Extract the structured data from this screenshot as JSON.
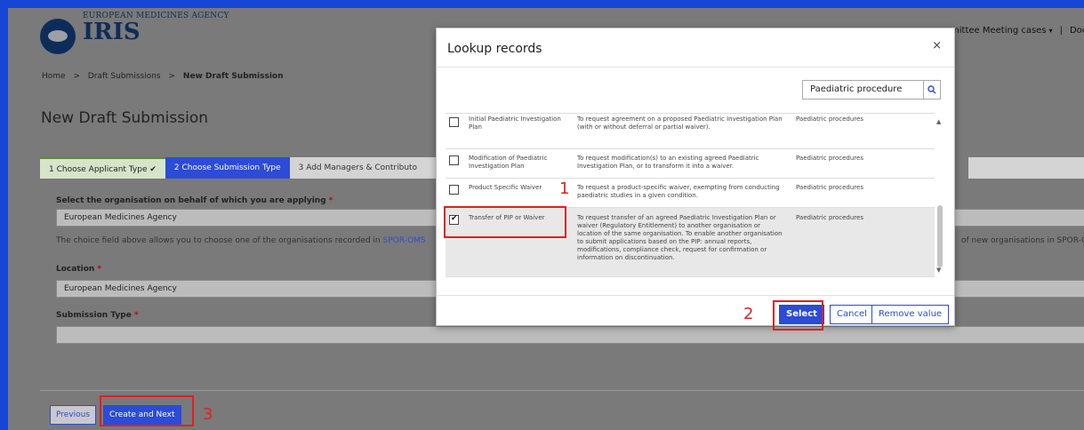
{
  "header": {
    "agency": "EUROPEAN MEDICINES AGENCY",
    "app_name": "IRIS",
    "nav_menu": "mittee Meeting cases",
    "nav_doc": "Doc"
  },
  "breadcrumb": {
    "home": "Home",
    "drafts": "Draft Submissions",
    "current": "New Draft Submission",
    "sep": ">"
  },
  "page_title": "New Draft Submission",
  "steps": {
    "step1": "1  Choose Applicant Type",
    "step1_check": "✔",
    "step2": "2  Choose Submission Type",
    "step3": "3  Add Managers & Contributo"
  },
  "form": {
    "org_label": "Select the organisation on behalf of which you are applying",
    "org_value": "European Medicines Agency",
    "info_text": "The choice field above allows you to choose one of the organisations recorded in ",
    "info_link": "SPOR-OMS",
    "info_right": "of new organisations in SPOR-O",
    "location_label": "Location",
    "location_value": "European Medicines Agency",
    "submission_type_label": "Submission Type",
    "submission_type_value": "",
    "required_mark": "*"
  },
  "footer": {
    "previous_label": "Previous",
    "create_label": "Create and Next"
  },
  "annotations": {
    "one": "1",
    "two": "2",
    "three": "3"
  },
  "modal": {
    "title": "Lookup records",
    "close": "×",
    "search_value": "Paediatric procedure",
    "rows": [
      {
        "name": "Initial Paediatric Investigation Plan",
        "description": "To request agreement on a proposed Paediatric Investigation Plan (with or without deferral or partial waiver).",
        "type": "Paediatric procedures",
        "checked": false
      },
      {
        "name": "Modification of Paediatric Investigation Plan",
        "description": "To request modification(s) to an existing agreed Paediatric Investigation Plan, or to transform it into a waiver.",
        "type": "Paediatric procedures",
        "checked": false
      },
      {
        "name": "Product Specific Waiver",
        "description": "To request a product-specific waiver, exempting from conducting paediatric studies in a given condition.",
        "type": "Paediatric procedures",
        "checked": false
      },
      {
        "name": "Transfer of PIP or Waiver",
        "description": "To request transfer of an agreed Paediatric Investigation Plan or waiver (Regulatory Entitlement) to another organisation or location of the same organisation. To enable another organisation to submit applications based on the PIP: annual reports, modifications, compliance check, request for confirmation or information on discontinuation.",
        "type": "Paediatric procedures",
        "checked": true
      }
    ],
    "select_label": "Select",
    "cancel_label": "Cancel",
    "remove_label": "Remove value"
  }
}
